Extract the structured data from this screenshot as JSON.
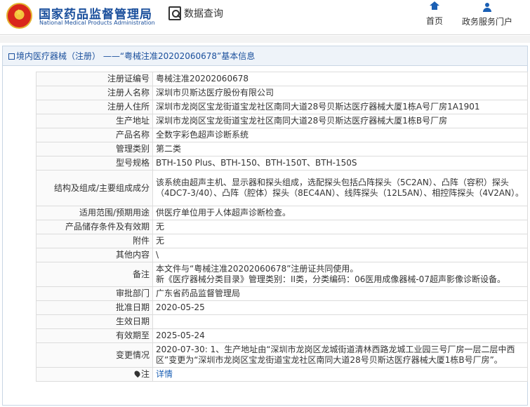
{
  "header": {
    "site_name_cn": "国家药品监督管理局",
    "site_name_en": "National Medical Products Administration",
    "search_label": "数据查询",
    "nav": [
      {
        "label": "首页",
        "icon": "home-icon"
      },
      {
        "label": "政务服务门户",
        "icon": "user-icon"
      }
    ]
  },
  "panel": {
    "title": "境内医疗器械（注册） ——“粤械注准20202060678”基本信息"
  },
  "rows": [
    {
      "key": "注册证编号",
      "value": "粤械注准20202060678"
    },
    {
      "key": "注册人名称",
      "value": "深圳市贝斯达医疗股份有限公司"
    },
    {
      "key": "注册人住所",
      "value": "深圳市龙岗区宝龙街道宝龙社区南同大道28号贝斯达医疗器械大厦1栋A号厂房1A1901"
    },
    {
      "key": "生产地址",
      "value": "深圳市龙岗区宝龙街道宝龙社区南同大道28号贝斯达医疗器械大厦1栋B号厂房"
    },
    {
      "key": "产品名称",
      "value": "全数字彩色超声诊断系统"
    },
    {
      "key": "管理类别",
      "value": "第二类"
    },
    {
      "key": "型号规格",
      "value": "BTH-150 Plus、BTH-150、BTH-150T、BTH-150S"
    },
    {
      "key": "结构及组成/主要组成成分",
      "value": "该系统由超声主机、显示器和探头组成，选配探头包括凸阵探头（5C2AN）、凸阵（容积）探头（4DC7-3/40）、凸阵（腔体）探头（8EC4AN）、线阵探头（12L5AN）、相控阵探头（4V2AN）。"
    },
    {
      "key": "适用范围/预期用途",
      "value": "供医疗单位用于人体超声诊断检查。"
    },
    {
      "key": "产品储存条件及有效期",
      "value": "无"
    },
    {
      "key": "附件",
      "value": "无"
    },
    {
      "key": "其他内容",
      "value": "\\"
    },
    {
      "key": "备注",
      "value": "本文件与“粤械注准20202060678”注册证共同使用。\n新《医疗器械分类目录》管理类别：II类，分类编码：06医用成像器械-07超声影像诊断设备。"
    },
    {
      "key": "审批部门",
      "value": "广东省药品监督管理局"
    },
    {
      "key": "批准日期",
      "value": "2020-05-25"
    },
    {
      "key": "生效日期",
      "value": ""
    },
    {
      "key": "有效期至",
      "value": "2025-05-24"
    },
    {
      "key": "变更情况",
      "value": "2020-07-30: 1、生产地址由“深圳市龙岗区龙城街道清林西路龙城工业园三号厂房一层二层中西区”变更为“深圳市龙岗区宝龙街道宝龙社区南同大道28号贝斯达医疗器械大厦1栋B号厂房”。"
    },
    {
      "key": "注",
      "value": "详情"
    }
  ]
}
